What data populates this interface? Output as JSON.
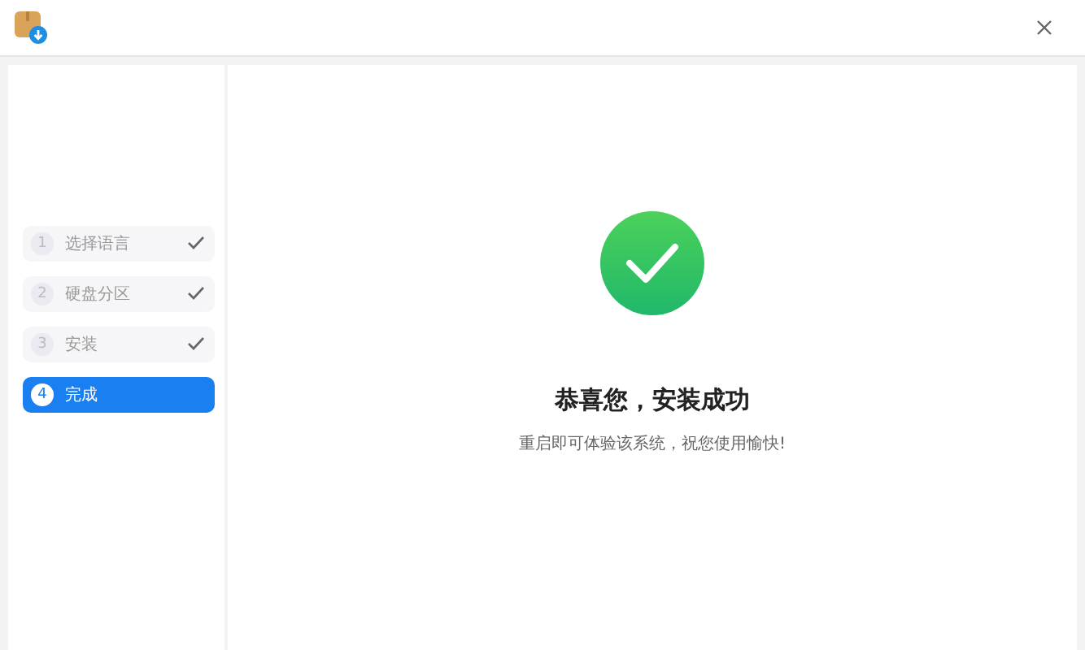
{
  "steps": [
    {
      "number": "1",
      "label": "选择语言",
      "done": true,
      "selected": false
    },
    {
      "number": "2",
      "label": "硬盘分区",
      "done": true,
      "selected": false
    },
    {
      "number": "3",
      "label": "安装",
      "done": true,
      "selected": false
    },
    {
      "number": "4",
      "label": "完成",
      "done": false,
      "selected": true
    }
  ],
  "result": {
    "title": "恭喜您，安装成功",
    "message": "重启即可体验该系统，祝您使用愉快!"
  }
}
